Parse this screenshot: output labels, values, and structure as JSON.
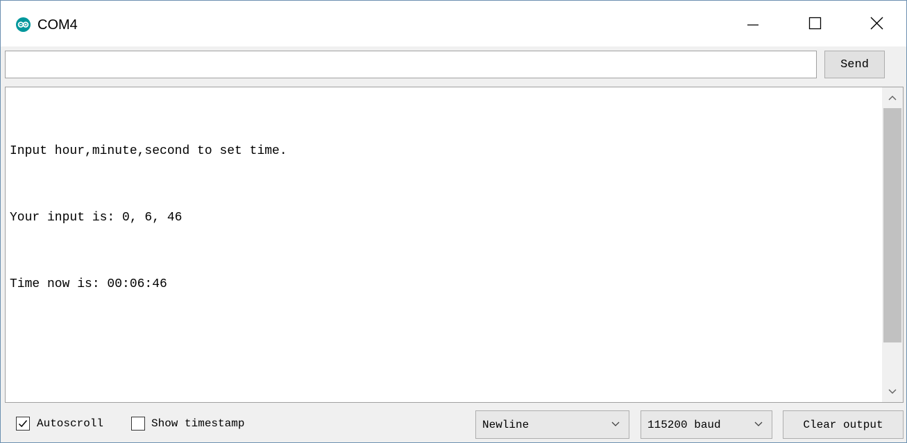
{
  "window": {
    "title": "COM4",
    "app_icon": "arduino-icon",
    "controls": [
      "minimize-icon",
      "maximize-icon",
      "close-icon"
    ]
  },
  "send_bar": {
    "input_value": "",
    "send_label": "Send"
  },
  "output": {
    "lines": [
      "Input hour,minute,second to set time.",
      "Your input is: 0, 6, 46",
      "Time now is: 00:06:46"
    ]
  },
  "bottom_bar": {
    "autoscroll_label": "Autoscroll",
    "autoscroll_checked": true,
    "timestamp_label": "Show timestamp",
    "timestamp_checked": false,
    "line_ending": "Newline",
    "baud_rate": "115200 baud",
    "clear_label": "Clear output"
  },
  "colors": {
    "accent": "#00979c",
    "window_bg": "#f0f0f0",
    "button_bg": "#e1e1e1",
    "scroll_thumb": "#c1c1c1"
  }
}
